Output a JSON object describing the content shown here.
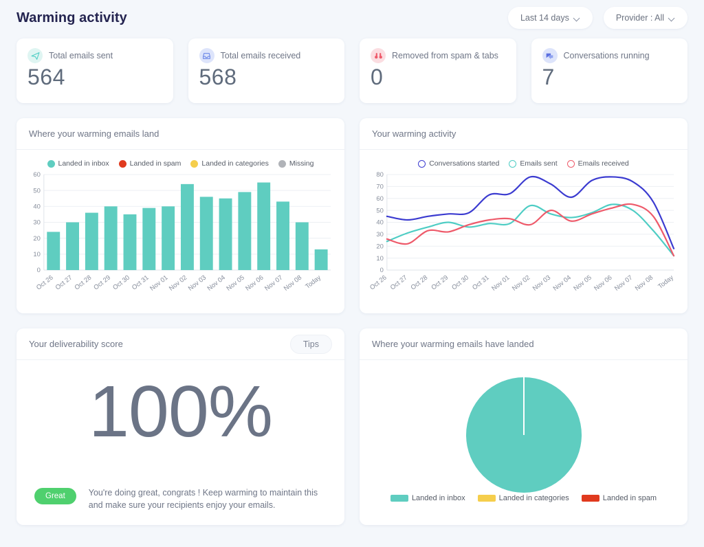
{
  "header": {
    "title": "Warming activity",
    "filters": [
      {
        "label": "Last 14 days",
        "icon": "chevron-down-icon"
      },
      {
        "label": "Provider : All",
        "icon": "chevron-down-icon"
      }
    ]
  },
  "stats": [
    {
      "label": "Total emails sent",
      "value": "564",
      "icon": "paper-plane-icon",
      "icon_color": "#4ecdc4",
      "icon_bg": "#dff5f2"
    },
    {
      "label": "Total emails received",
      "value": "568",
      "icon": "inbox-icon",
      "icon_color": "#6b86e8",
      "icon_bg": "#dde4fb"
    },
    {
      "label": "Removed from spam & tabs",
      "value": "0",
      "icon": "binoculars-icon",
      "icon_color": "#ee5a6a",
      "icon_bg": "#fbdde1"
    },
    {
      "label": "Conversations running",
      "value": "7",
      "icon": "chat-bubbles-icon",
      "icon_bg": "#dde4fb",
      "icon_color": "#5b6fe0"
    }
  ],
  "panels": {
    "bar": {
      "title": "Where your warming emails land"
    },
    "line": {
      "title": "Your warming activity"
    },
    "score": {
      "title": "Your deliverability score",
      "tips_label": "Tips",
      "value": "100%",
      "badge": "Great",
      "message": "You're doing great, congrats ! Keep warming to maintain this and make sure your recipients enjoy your emails."
    },
    "pie": {
      "title": "Where your warming emails have landed"
    }
  },
  "colors": {
    "teal": "#5fcdc0",
    "red": "#e03a1e",
    "yellow": "#f5ce4c",
    "gray": "#b0b3b8",
    "blue": "#3b3bd0",
    "line_teal": "#4ecdc4",
    "line_red": "#ee5a6a",
    "green": "#4fd06e",
    "background": "#f4f7fb"
  },
  "chart_data": [
    {
      "type": "bar",
      "title": "Where your warming emails land",
      "xlabel": "",
      "ylabel": "",
      "ylim": [
        0,
        60
      ],
      "yticks": [
        0,
        10,
        20,
        30,
        40,
        50,
        60
      ],
      "grid": true,
      "legend_position": "top",
      "legend": [
        {
          "label": "Landed in inbox",
          "color": "#5fcdc0"
        },
        {
          "label": "Landed in spam",
          "color": "#e03a1e"
        },
        {
          "label": "Landed in categories",
          "color": "#f5ce4c"
        },
        {
          "label": "Missing",
          "color": "#b0b3b8"
        }
      ],
      "categories": [
        "Oct 26",
        "Oct 27",
        "Oct 28",
        "Oct 29",
        "Oct 30",
        "Oct 31",
        "Nov 01",
        "Nov 02",
        "Nov 03",
        "Nov 04",
        "Nov 05",
        "Nov 06",
        "Nov 07",
        "Nov 08",
        "Today"
      ],
      "series": [
        {
          "name": "Landed in inbox",
          "color": "#5fcdc0",
          "values": [
            24,
            30,
            36,
            40,
            35,
            39,
            40,
            54,
            46,
            45,
            49,
            55,
            43,
            30,
            13
          ]
        },
        {
          "name": "Landed in spam",
          "color": "#e03a1e",
          "values": [
            0,
            0,
            0,
            0,
            0,
            0,
            0,
            0,
            0,
            0,
            0,
            0,
            0,
            0,
            0
          ]
        },
        {
          "name": "Landed in categories",
          "color": "#f5ce4c",
          "values": [
            0,
            0,
            0,
            0,
            0,
            0,
            0,
            0,
            0,
            0,
            0,
            0,
            0,
            0,
            0
          ]
        },
        {
          "name": "Missing",
          "color": "#b0b3b8",
          "values": [
            0,
            0,
            0,
            0,
            0,
            0,
            0,
            0,
            0,
            0,
            0,
            0,
            0,
            0,
            0
          ]
        }
      ]
    },
    {
      "type": "line",
      "title": "Your warming activity",
      "xlabel": "",
      "ylabel": "",
      "ylim": [
        0,
        80
      ],
      "yticks": [
        0,
        10,
        20,
        30,
        40,
        50,
        60,
        70,
        80
      ],
      "grid": true,
      "legend_position": "top",
      "x": [
        "Oct 26",
        "Oct 27",
        "Oct 28",
        "Oct 29",
        "Oct 30",
        "Oct 31",
        "Nov 01",
        "Nov 02",
        "Nov 03",
        "Nov 04",
        "Nov 05",
        "Nov 06",
        "Nov 07",
        "Nov 08",
        "Today"
      ],
      "series": [
        {
          "name": "Conversations started",
          "color": "#3b3bd0",
          "values": [
            45,
            42,
            45,
            47,
            48,
            63,
            64,
            78,
            72,
            61,
            75,
            78,
            74,
            57,
            18
          ]
        },
        {
          "name": "Emails sent",
          "color": "#4ecdc4",
          "values": [
            24,
            31,
            36,
            40,
            36,
            39,
            39,
            54,
            47,
            44,
            48,
            55,
            50,
            33,
            12
          ]
        },
        {
          "name": "Emails received",
          "color": "#ee5a6a",
          "values": [
            26,
            22,
            33,
            32,
            38,
            42,
            43,
            38,
            50,
            41,
            47,
            52,
            55,
            45,
            12
          ]
        }
      ]
    },
    {
      "type": "pie",
      "title": "Where your warming emails have landed",
      "legend_position": "bottom",
      "labels": [
        "Landed in inbox",
        "Landed in categories",
        "Landed in spam"
      ],
      "values": [
        100,
        0,
        0
      ],
      "colors": [
        "#5fcdc0",
        "#f5ce4c",
        "#e03a1e"
      ]
    }
  ]
}
